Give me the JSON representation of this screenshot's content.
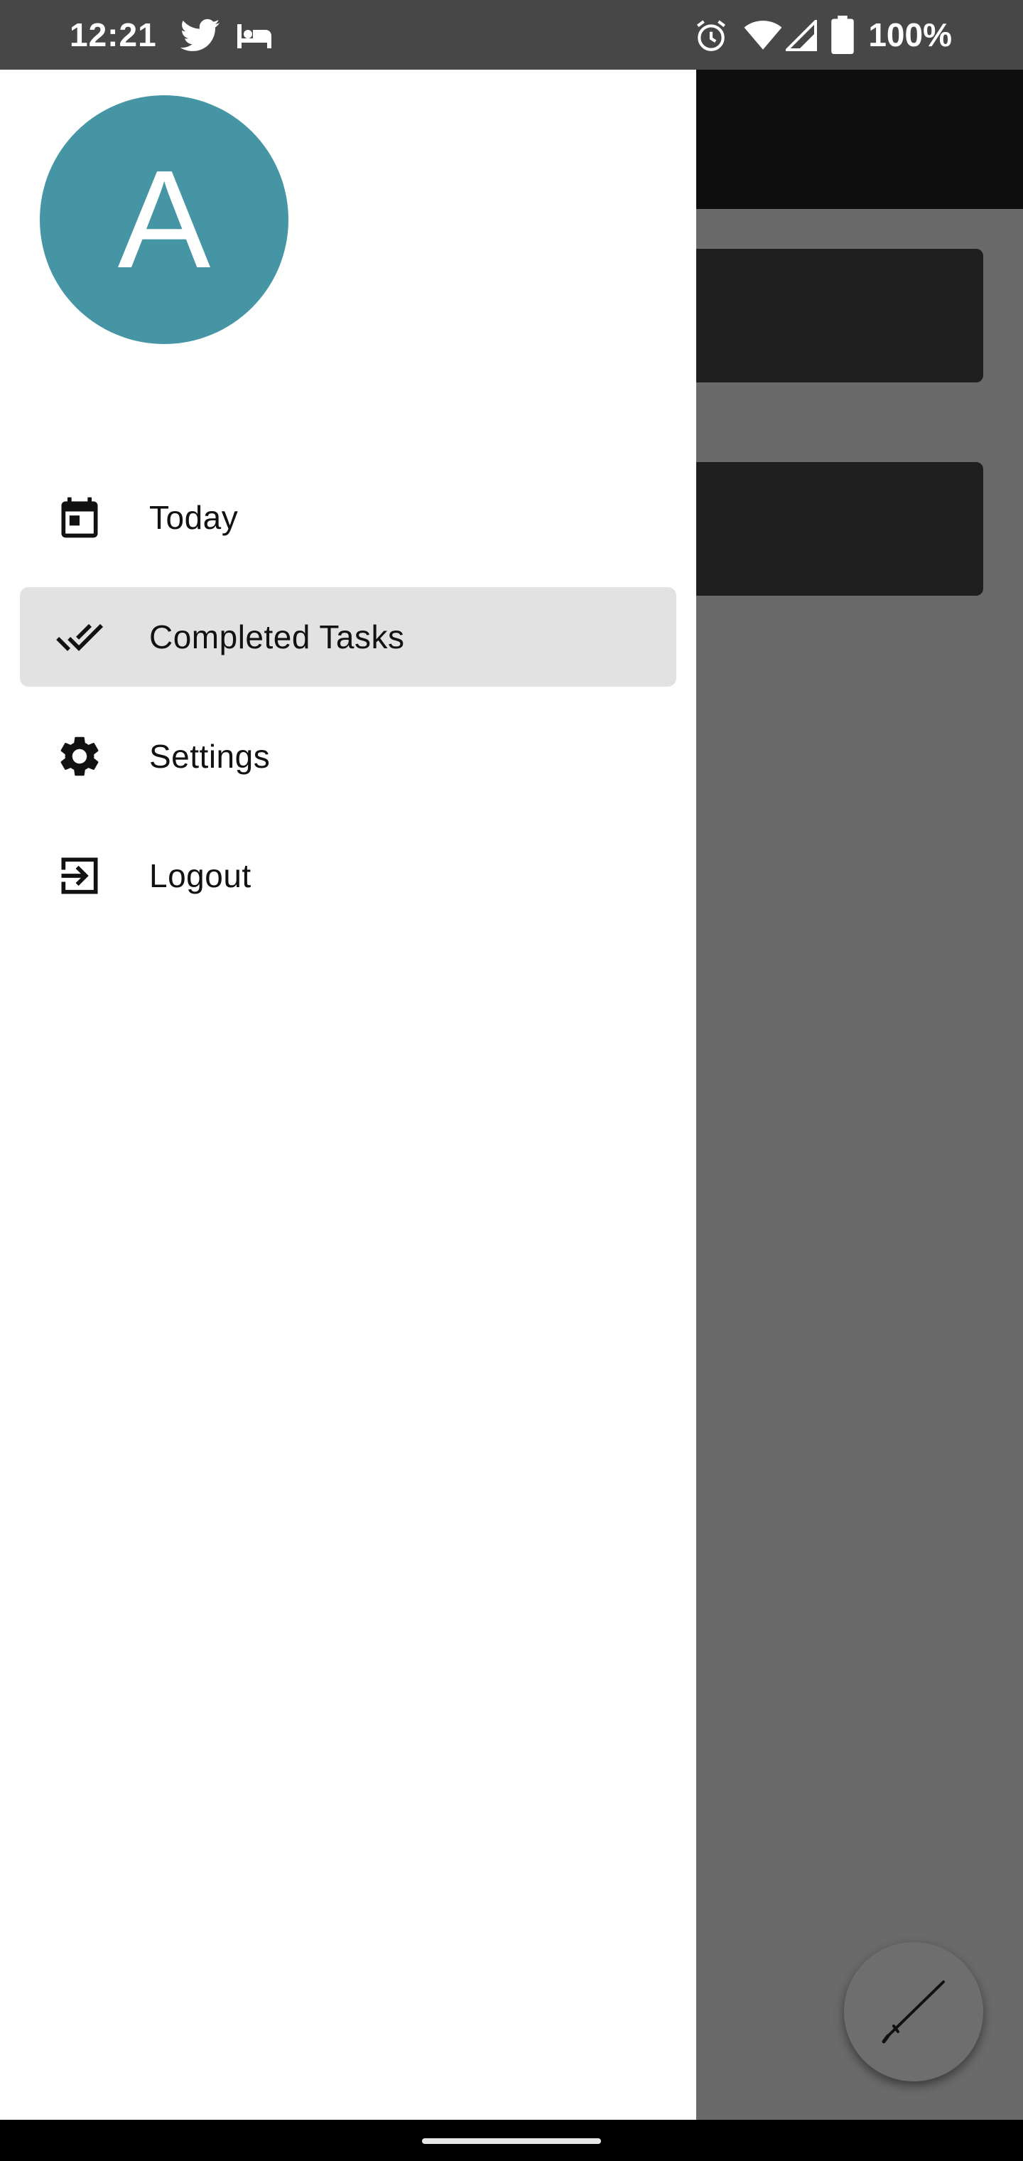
{
  "status_bar": {
    "time": "12:21",
    "battery_text": "100%",
    "left_icons": [
      "twitter-icon",
      "hotel-icon"
    ],
    "right_icons": [
      "alarm-icon",
      "wifi-icon",
      "signal-icon",
      "battery-icon"
    ]
  },
  "drawer": {
    "avatar_letter": "A",
    "avatar_color": "#4595a5",
    "selected_index": 1,
    "items": [
      {
        "label": "Today",
        "icon": "calendar-icon"
      },
      {
        "label": "Completed Tasks",
        "icon": "double-check-icon"
      },
      {
        "label": "Settings",
        "icon": "gear-icon"
      },
      {
        "label": "Logout",
        "icon": "logout-icon"
      }
    ]
  },
  "fab": {
    "icon": "edit-icon"
  },
  "colors": {
    "scrim": "#6a6a6a",
    "selected_item": "#e2e2e2",
    "status_bar": "#474747"
  }
}
